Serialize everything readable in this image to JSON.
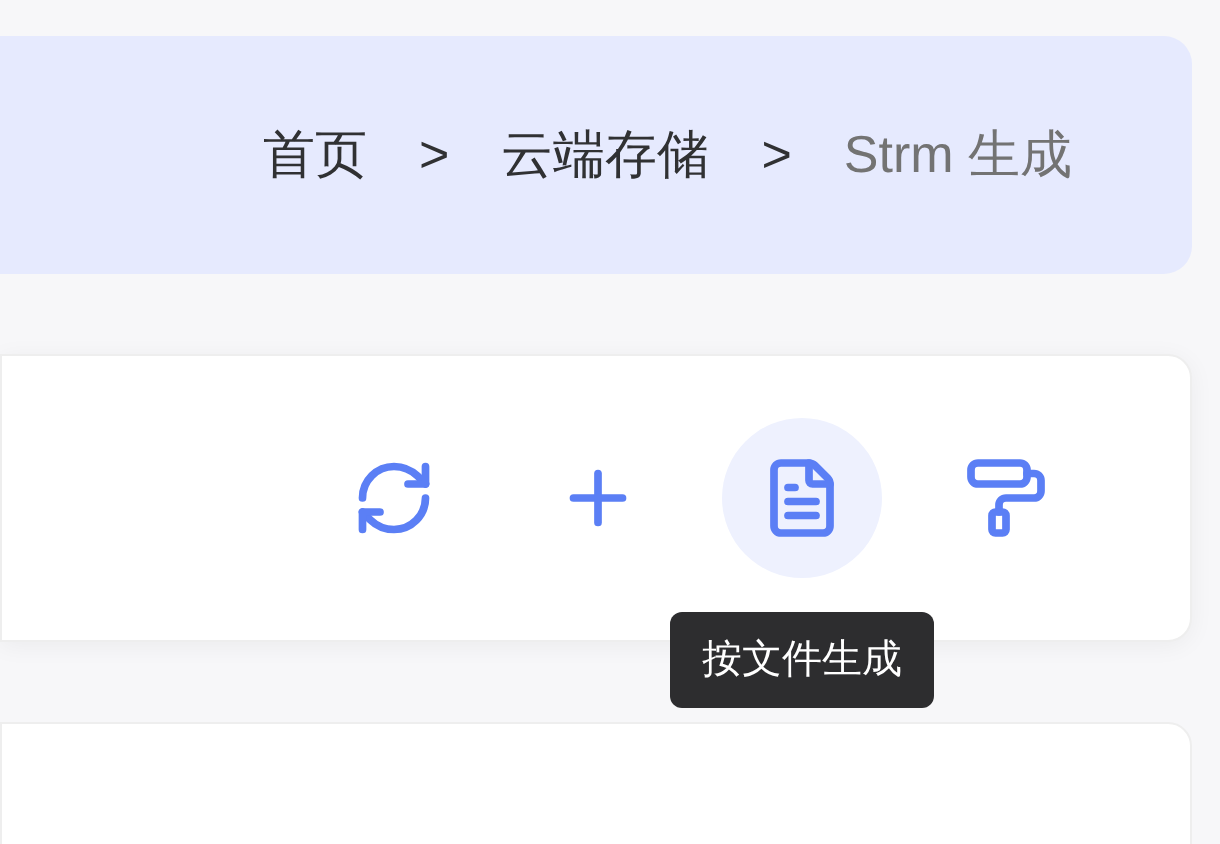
{
  "breadcrumb": [
    {
      "label": "首页",
      "current": false
    },
    {
      "label": "云端存储",
      "current": false
    },
    {
      "label": "Strm 生成",
      "current": true
    }
  ],
  "breadcrumb_separator": ">",
  "toolbar": [
    {
      "kind": "refresh",
      "highlighted": false
    },
    {
      "kind": "add",
      "highlighted": false
    },
    {
      "kind": "file",
      "highlighted": true,
      "tooltip": "按文件生成"
    },
    {
      "kind": "roller",
      "highlighted": false
    }
  ]
}
